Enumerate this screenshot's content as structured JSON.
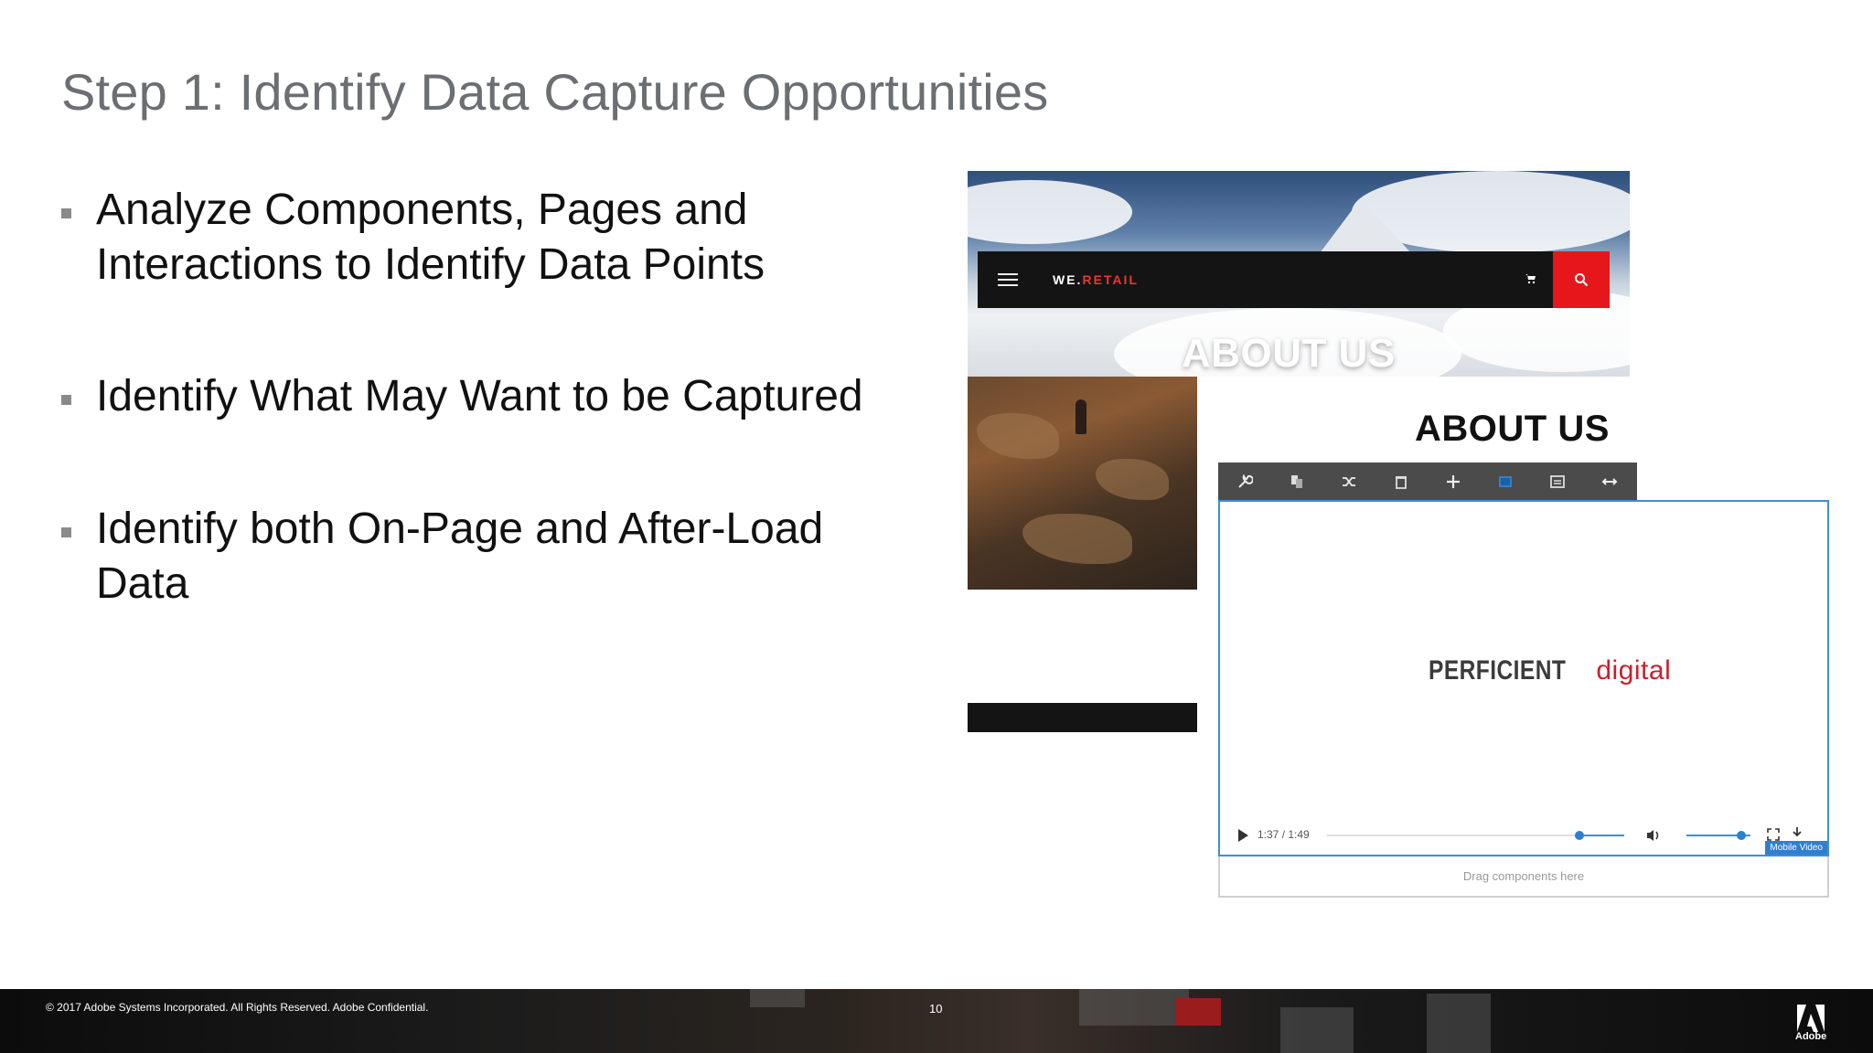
{
  "slide": {
    "title": "Step 1: Identify Data Capture Opportunities",
    "bullets": [
      "Analyze Components, Pages and Interactions to Identify Data Points",
      "Identify What May Want to be Captured",
      "Identify both On-Page and After-Load Data"
    ]
  },
  "screenshot": {
    "brand_prefix": "WE.",
    "brand_accent": "RETAIL",
    "hero_heading": "ABOUT US",
    "page_heading": "ABOUT US",
    "toolbar_icons": [
      "wrench-icon",
      "copy-icon",
      "shuffle-icon",
      "trash-icon",
      "plus-icon",
      "image-icon",
      "layers-icon",
      "resize-icon"
    ],
    "logo_dark": "PERFICIENT",
    "logo_red": "digital",
    "video_time": "1:37 / 1:49",
    "video_progress": 0.15,
    "volume_level": 0.85,
    "component_label": "Mobile Video",
    "dropzone_text": "Drag components here",
    "accent_red": "#e5171b",
    "accent_blue": "#3c8fd3"
  },
  "footer": {
    "copyright": "© 2017 Adobe Systems Incorporated.  All Rights Reserved.  Adobe Confidential.",
    "page_number": "10",
    "logo_text": "Adobe"
  }
}
